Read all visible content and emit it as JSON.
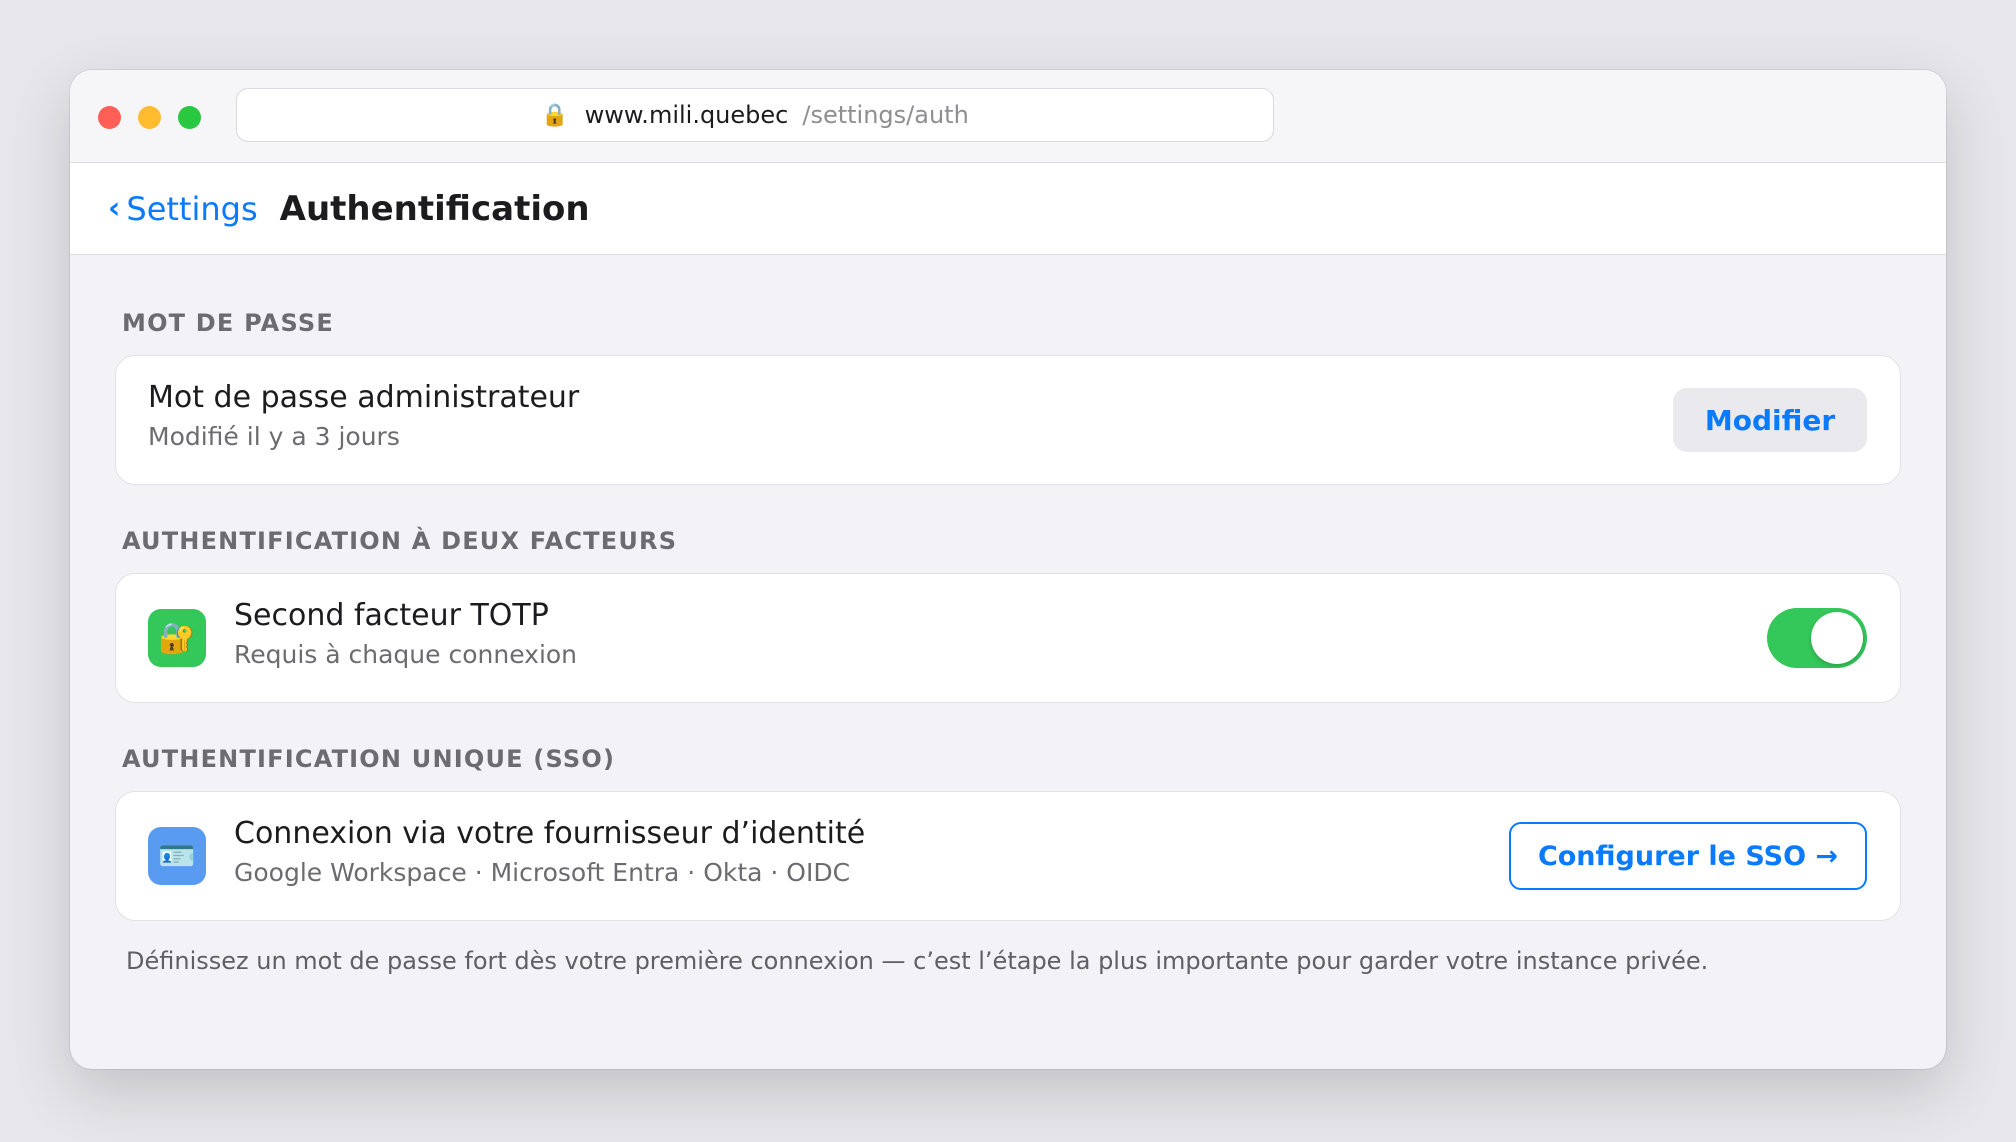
{
  "browser": {
    "domain": "www.mili.quebec",
    "path": "/settings/auth"
  },
  "nav": {
    "back_label": "Settings",
    "title": "Authentification"
  },
  "sections": {
    "password": {
      "header": "MOT DE PASSE",
      "title": "Mot de passe administrateur",
      "subtitle": "Modifié il y a 3 jours",
      "button": "Modifier"
    },
    "twofa": {
      "header": "AUTHENTIFICATION À DEUX FACTEURS",
      "title": "Second facteur TOTP",
      "subtitle": "Requis à chaque connexion",
      "icon": "lock-key-icon",
      "toggle_on": true
    },
    "sso": {
      "header": "AUTHENTIFICATION UNIQUE (SSO)",
      "title": "Connexion via votre fournisseur d’identité",
      "subtitle": "Google Workspace · Microsoft Entra · Okta · OIDC",
      "icon": "id-card-icon",
      "button": "Configurer le SSO →"
    }
  },
  "footer": "Définissez un mot de passe fort dès votre première connexion — c’est l’étape la plus importante pour garder votre instance privée.",
  "colors": {
    "accent": "#0a7aff",
    "toggle_on": "#34c759",
    "twofa_icon_bg": "#34c759",
    "sso_icon_bg": "#5a9bf2"
  }
}
